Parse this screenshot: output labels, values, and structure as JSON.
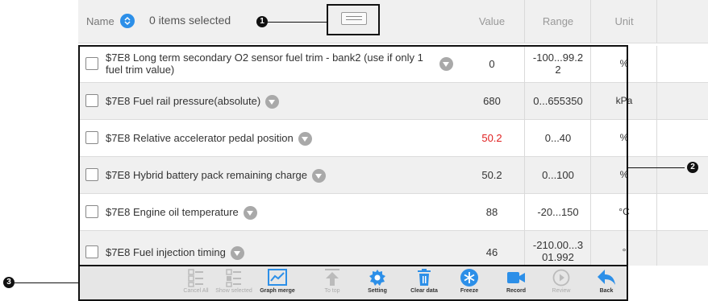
{
  "header": {
    "name_label": "Name",
    "selected_text": "0 items selected",
    "col_value": "Value",
    "col_range": "Range",
    "col_unit": "Unit"
  },
  "callouts": [
    "1",
    "2",
    "3"
  ],
  "rows": [
    {
      "name_line1": "$7E8 Long term secondary O2 sensor fuel trim - bank2 (use if only 1",
      "name_line2": "fuel trim value)",
      "value": "0",
      "range_line1": "-100...99.2",
      "range_line2": "2",
      "unit": "%"
    },
    {
      "name": "$7E8 Fuel rail pressure(absolute)",
      "value": "680",
      "range": "0...655350",
      "unit": "kPa"
    },
    {
      "name": "$7E8 Relative accelerator pedal position",
      "value": "50.2",
      "range": "0...40",
      "unit": "%",
      "alarm": true
    },
    {
      "name": "$7E8 Hybrid battery pack remaining charge",
      "value": "50.2",
      "range": "0...100",
      "unit": "%"
    },
    {
      "name": "$7E8 Engine oil temperature",
      "value": "88",
      "range": "-20...150",
      "unit": "°C"
    },
    {
      "name": "$7E8 Fuel injection timing",
      "value": "46",
      "range_line1": "-210.00...3",
      "range_line2": "01.992",
      "unit": "°"
    }
  ],
  "toolbar": [
    {
      "label": "Cancel All",
      "icon": "cancel-all-icon",
      "enabled": false
    },
    {
      "label": "Show selected",
      "icon": "show-selected-icon",
      "enabled": false
    },
    {
      "label": "Graph merge",
      "icon": "graph-merge-icon",
      "enabled": true
    },
    {
      "label": "To top",
      "icon": "to-top-icon",
      "enabled": false
    },
    {
      "label": "Setting",
      "icon": "setting-icon",
      "enabled": true
    },
    {
      "label": "Clear data",
      "icon": "clear-data-icon",
      "enabled": true
    },
    {
      "label": "Freeze",
      "icon": "freeze-icon",
      "enabled": true
    },
    {
      "label": "Record",
      "icon": "record-icon",
      "enabled": true
    },
    {
      "label": "Review",
      "icon": "review-icon",
      "enabled": false
    },
    {
      "label": "Back",
      "icon": "back-icon",
      "enabled": true
    }
  ],
  "colors": {
    "accent": "#2c8fe8",
    "alarm": "#e02020"
  }
}
